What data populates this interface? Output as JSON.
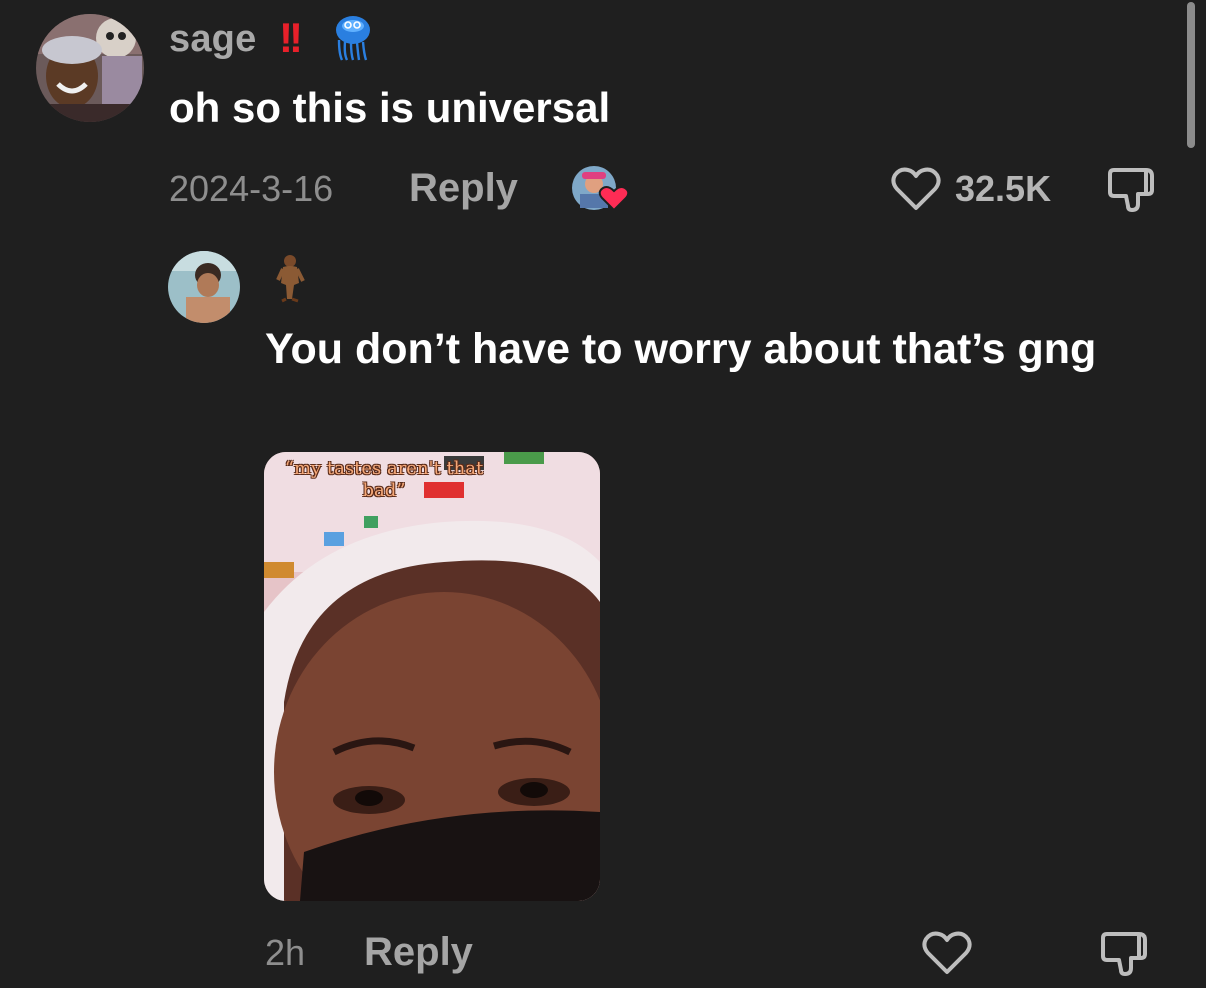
{
  "comments": [
    {
      "username": "sage",
      "badge_text": "!!",
      "badge_emoji": "jellyfish-icon",
      "text": "oh so this is universal",
      "date": "2024-3-16",
      "reply_label": "Reply",
      "likes": "32.5K",
      "creator_liked": true
    }
  ],
  "reply": {
    "username_emoji": "sasquatch-icon",
    "text": "You don’t have to worry about that’s gng",
    "media_caption": "“my tastes aren't that bad”",
    "time": "2h",
    "reply_label": "Reply"
  },
  "colors": {
    "background": "#1f1f1f",
    "username": "#a9a9a9",
    "accent_red": "#e8202a",
    "meta": "#8e8e8e"
  }
}
